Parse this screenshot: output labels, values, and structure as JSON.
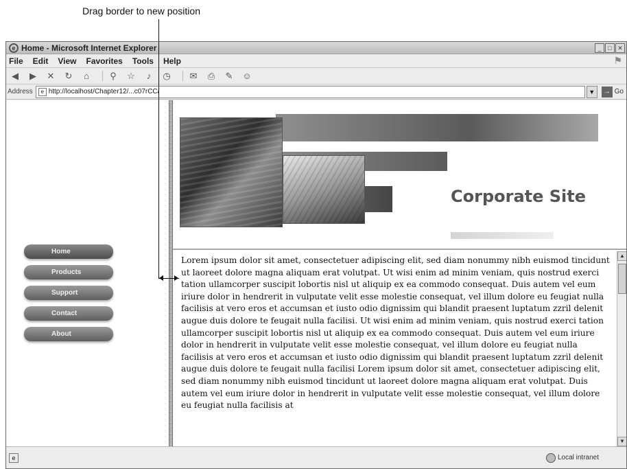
{
  "callout": {
    "text": "Drag border to new position"
  },
  "window": {
    "title": "Home - Microsoft Internet Explorer",
    "controls": [
      "_",
      "□",
      "✕"
    ]
  },
  "menubar": [
    "File",
    "Edit",
    "View",
    "Favorites",
    "Tools",
    "Help"
  ],
  "toolbar_icons": [
    "back-icon",
    "forward-icon",
    "stop-icon",
    "refresh-icon",
    "home-icon",
    "search-icon",
    "favorites-icon",
    "media-icon",
    "history-icon",
    "mail-icon",
    "print-icon",
    "edit-icon",
    "messenger-icon"
  ],
  "address": {
    "label": "Address",
    "url": "http://localhost/Chapter12/...c07rCC/",
    "go_label": "Go"
  },
  "nav": {
    "items": [
      "Home",
      "Products",
      "Support",
      "Contact",
      "About"
    ],
    "active": "Home"
  },
  "banner": {
    "title": "Corporate Site"
  },
  "body_text": "Lorem ipsum dolor sit amet, consectetuer adipiscing elit, sed diam nonummy nibh euismod tincidunt ut laoreet dolore magna aliquam erat volutpat. Ut wisi enim ad minim veniam, quis nostrud exerci tation ullamcorper suscipit lobortis nisl ut aliquip ex ea commodo consequat. Duis autem vel eum iriure dolor in hendrerit in vulputate velit esse molestie consequat, vel illum dolore eu feugiat nulla facilisis at vero eros et accumsan et iusto odio dignissim qui blandit praesent luptatum zzril delenit augue duis dolore te feugait nulla facilisi. Ut wisi enim ad minim veniam, quis nostrud exerci tation ullamcorper suscipit lobortis nisl ut aliquip ex ea commodo consequat. Duis autem vel eum iriure dolor in hendrerit in vulputate velit esse molestie consequat, vel illum dolore eu feugiat nulla facilisis at vero eros et accumsan et iusto odio dignissim qui blandit praesent luptatum zzril delenit augue duis dolore te feugait nulla facilisi Lorem ipsum dolor sit amet, consectetuer adipiscing elit, sed diam nonummy nibh euismod tincidunt ut laoreet dolore magna aliquam erat volutpat. Duis autem vel eum iriure dolor in hendrerit in vulputate velit esse molestie consequat, vel illum dolore eu feugiat nulla facilisis at",
  "status": {
    "zone": "Local intranet"
  }
}
